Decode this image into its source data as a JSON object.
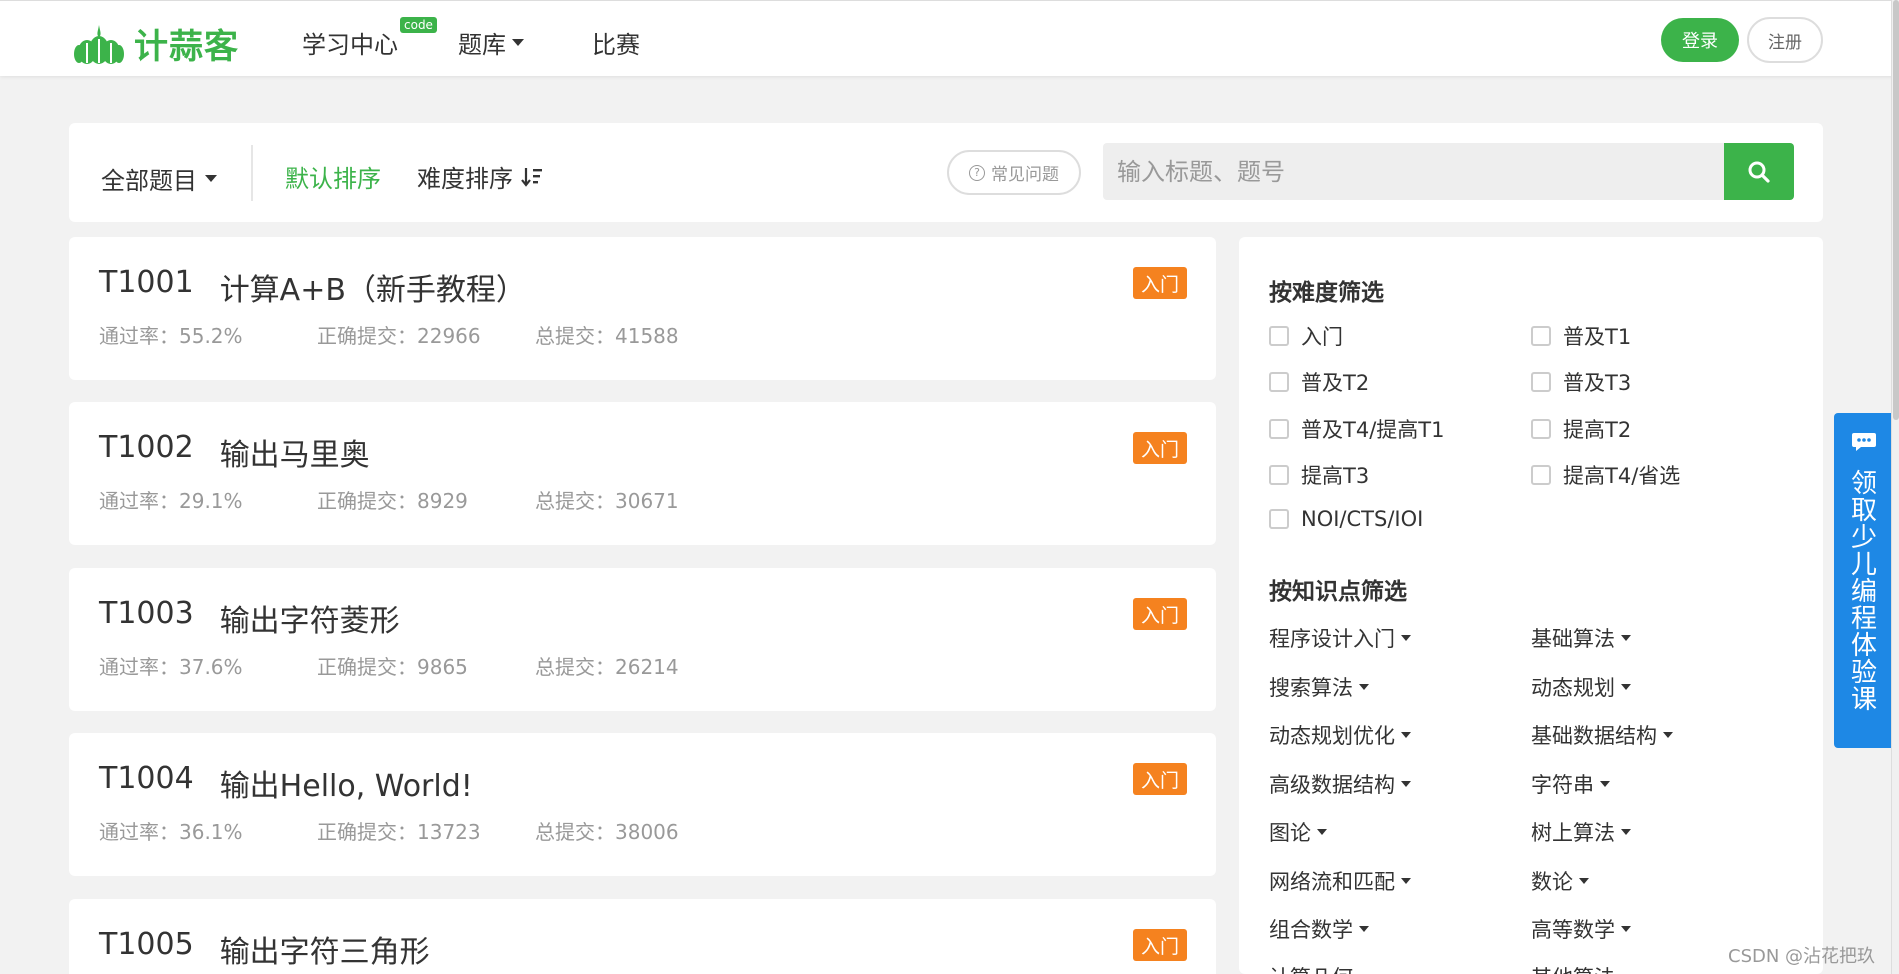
{
  "header": {
    "logo_text": "计蒜客",
    "nav": [
      {
        "label": "学习中心",
        "badge": "code"
      },
      {
        "label": "题库"
      },
      {
        "label": "比赛"
      }
    ],
    "login_label": "登录",
    "register_label": "注册"
  },
  "toolbar": {
    "all_problems": "全部题目",
    "default_sort": "默认排序",
    "difficulty_sort": "难度排序",
    "faq": "常见问题",
    "search_placeholder": "输入标题、题号"
  },
  "problems": [
    {
      "id": "T1001",
      "title": "计算A+B（新手教程）",
      "pass_rate_label": "通过率：",
      "pass_rate": "55.2%",
      "correct_label": "正确提交：",
      "correct": "22966",
      "total_label": "总提交：",
      "total": "41588",
      "level": "入门"
    },
    {
      "id": "T1002",
      "title": "输出马里奥",
      "pass_rate_label": "通过率：",
      "pass_rate": "29.1%",
      "correct_label": "正确提交：",
      "correct": "8929",
      "total_label": "总提交：",
      "total": "30671",
      "level": "入门"
    },
    {
      "id": "T1003",
      "title": "输出字符菱形",
      "pass_rate_label": "通过率：",
      "pass_rate": "37.6%",
      "correct_label": "正确提交：",
      "correct": "9865",
      "total_label": "总提交：",
      "total": "26214",
      "level": "入门"
    },
    {
      "id": "T1004",
      "title": "输出Hello, World!",
      "pass_rate_label": "通过率：",
      "pass_rate": "36.1%",
      "correct_label": "正确提交：",
      "correct": "13723",
      "total_label": "总提交：",
      "total": "38006",
      "level": "入门"
    },
    {
      "id": "T1005",
      "title": "输出字符三角形",
      "level": "入门"
    }
  ],
  "filter": {
    "difficulty_heading": "按难度筛选",
    "difficulty": [
      "入门",
      "普及T1",
      "普及T2",
      "普及T3",
      "普及T4/提高T1",
      "提高T2",
      "提高T3",
      "提高T4/省选",
      "NOI/CTS/IOI"
    ],
    "topic_heading": "按知识点筛选",
    "topics": [
      "程序设计入门",
      "基础算法",
      "搜索算法",
      "动态规划",
      "动态规划优化",
      "基础数据结构",
      "高级数据结构",
      "字符串",
      "图论",
      "树上算法",
      "网络流和匹配",
      "数论",
      "组合数学",
      "高等数学",
      "计算几何",
      "其他算法"
    ]
  },
  "promo": {
    "text": "领取少儿编程体验课"
  },
  "watermark": "CSDN @沾花把玖",
  "colors": {
    "brand_green": "#3cb34a",
    "level_orange": "#f5821f",
    "promo_blue": "#1e88e5"
  }
}
